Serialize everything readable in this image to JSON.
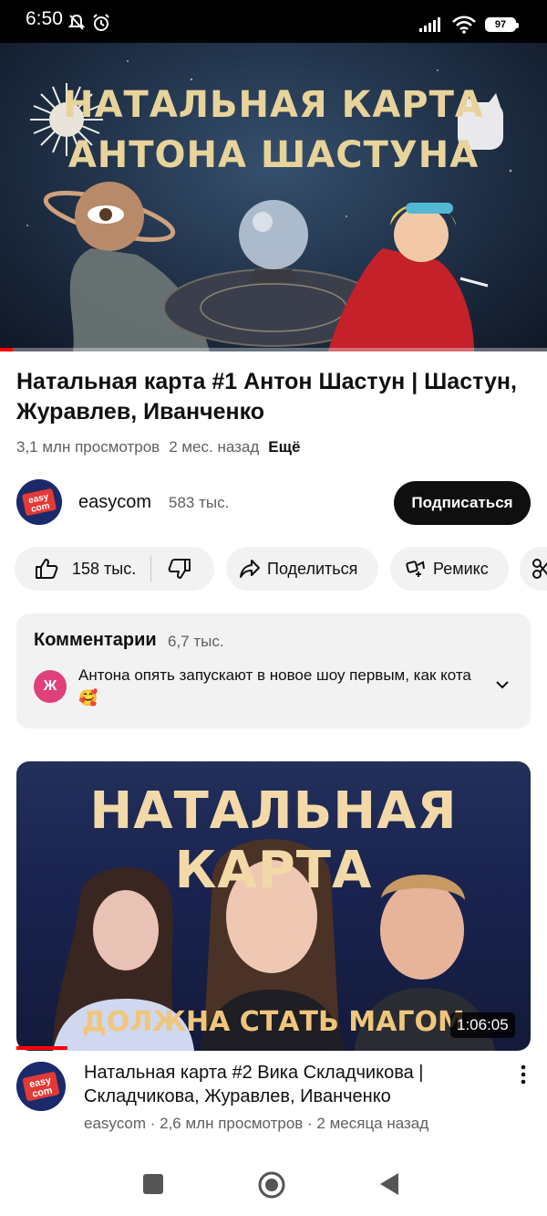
{
  "status_bar": {
    "time": "6:50",
    "battery": "97"
  },
  "player": {
    "title_line1": "НАТАЛЬНАЯ КАРТА",
    "title_line2": "АНТОНА ШАСТУНА",
    "progress_fraction": 0.023
  },
  "video": {
    "title": "Натальная карта #1 Антон Шастун | Шастун, Журавлев, Иванченко",
    "views": "3,1 млн просмотров",
    "age": "2 мес. назад",
    "more_label": "Ещё"
  },
  "channel": {
    "name": "easycom",
    "subscribers": "583 тыс.",
    "subscribe_label": "Подписаться",
    "logo_text_1": "easy",
    "logo_text_2": "com"
  },
  "actions": {
    "likes": "158 тыс.",
    "share_label": "Поделиться",
    "remix_label": "Ремикс"
  },
  "comments": {
    "header": "Комментарии",
    "count": "6,7 тыс.",
    "avatar_letter": "Ж",
    "top_comment": "Антона опять запускают в новое шоу первым, как кота🥰"
  },
  "recommended": {
    "thumb_title": "НАТАЛЬНАЯ КАРТА",
    "thumb_subtitle": "ДОЛЖНА СТАТЬ МАГОМ",
    "duration": "1:06:05",
    "title": "Натальная карта #2 Вика Складчикова | Складчикова, Журавлев, Иванченко",
    "meta": "easycom · 2,6 млн просмотров · 2 месяца назад",
    "progress_fraction": 0.1
  },
  "colors": {
    "accent_red": "#ff0000",
    "chip_bg": "#f2f2f2",
    "subscribe_bg": "#0f0f0f",
    "comment_avatar": "#e0407a"
  },
  "icons": [
    "mute-icon",
    "alarm-icon",
    "signal-icon",
    "wifi-icon",
    "battery-icon",
    "like-icon",
    "dislike-icon",
    "share-icon",
    "remix-icon",
    "clip-icon",
    "chevron-down-icon",
    "more-vertical-icon",
    "nav-recents-icon",
    "nav-home-icon",
    "nav-back-icon"
  ]
}
